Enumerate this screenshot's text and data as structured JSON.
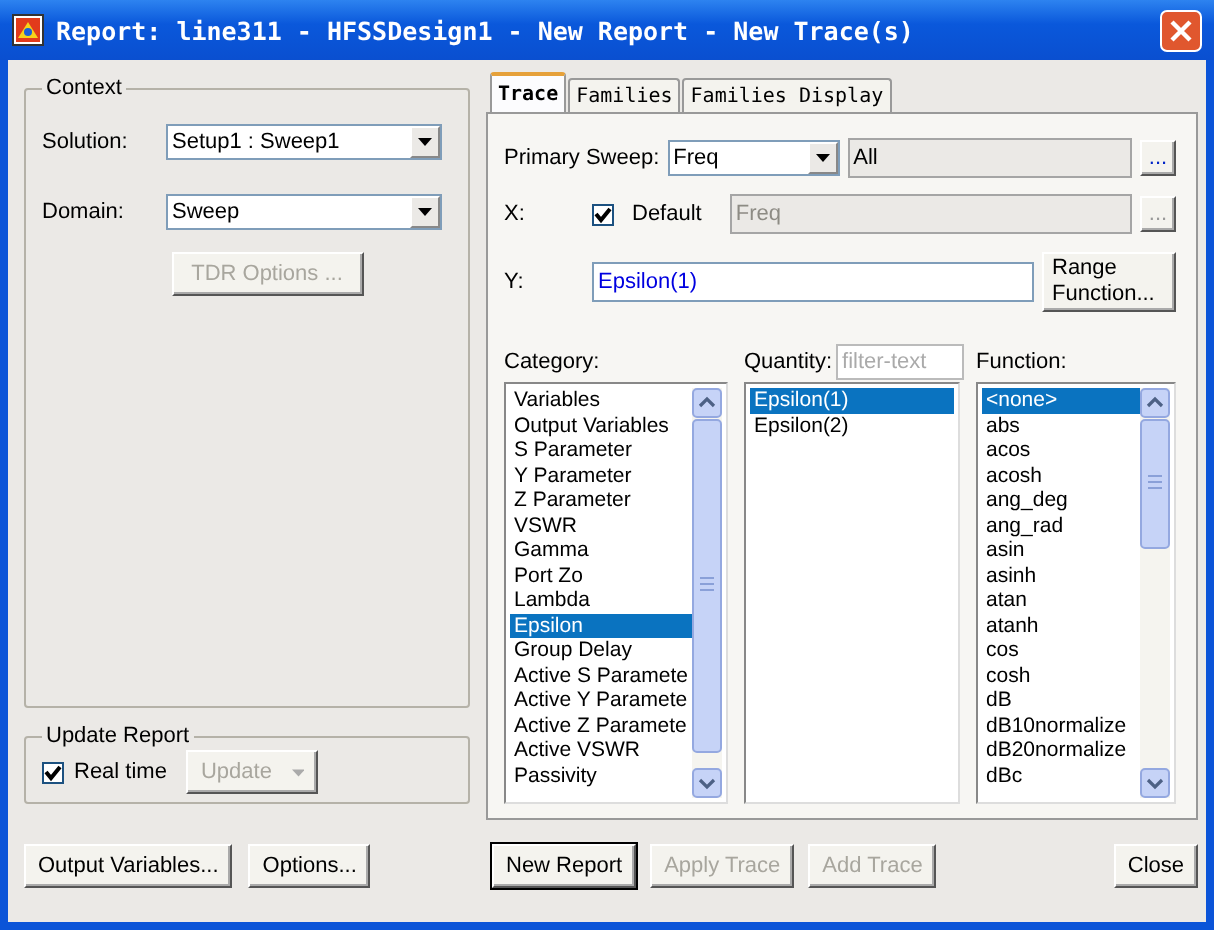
{
  "window": {
    "title": "Report: line311 - HFSSDesign1 - New Report - New Trace(s)"
  },
  "context": {
    "title": "Context",
    "solution": {
      "label": "Solution:",
      "value": "Setup1 : Sweep1"
    },
    "domain": {
      "label": "Domain:",
      "value": "Sweep"
    },
    "tdr_button": {
      "label": "TDR Options ...",
      "disabled": true
    }
  },
  "update_report": {
    "title": "Update Report",
    "real_time": {
      "label": "Real time",
      "checked": true
    },
    "update_button": {
      "label": "Update",
      "disabled": true
    }
  },
  "tabs": [
    {
      "label": "Trace",
      "selected": true
    },
    {
      "label": "Families",
      "selected": false
    },
    {
      "label": "Families Display",
      "selected": false
    }
  ],
  "primary_sweep": {
    "label": "Primary Sweep:",
    "value": "Freq",
    "range": "All",
    "browse": "..."
  },
  "x": {
    "label": "X:",
    "default": {
      "label": "Default",
      "checked": true
    },
    "value": "Freq",
    "browse": "...",
    "disabled": true
  },
  "y": {
    "label": "Y:",
    "value": "Epsilon(1)",
    "range_button": "Range\nFunction..."
  },
  "category": {
    "label": "Category:",
    "items": [
      {
        "label": "Variables",
        "selected": false
      },
      {
        "label": "Output Variables",
        "selected": false
      },
      {
        "label": "S Parameter",
        "selected": false
      },
      {
        "label": "Y Parameter",
        "selected": false
      },
      {
        "label": "Z Parameter",
        "selected": false
      },
      {
        "label": "VSWR",
        "selected": false
      },
      {
        "label": "Gamma",
        "selected": false
      },
      {
        "label": "Port Zo",
        "selected": false
      },
      {
        "label": "Lambda",
        "selected": false
      },
      {
        "label": "Epsilon",
        "selected": true
      },
      {
        "label": "Group Delay",
        "selected": false
      },
      {
        "label": "Active S Paramete",
        "selected": false
      },
      {
        "label": "Active Y Paramete",
        "selected": false
      },
      {
        "label": "Active Z Paramete",
        "selected": false
      },
      {
        "label": "Active VSWR",
        "selected": false
      },
      {
        "label": "Passivity",
        "selected": false
      }
    ]
  },
  "quantity": {
    "label": "Quantity:",
    "filter_placeholder": "filter-text",
    "items": [
      {
        "label": "Epsilon(1)",
        "selected": true
      },
      {
        "label": "Epsilon(2)",
        "selected": false
      }
    ]
  },
  "function": {
    "label": "Function:",
    "items": [
      {
        "label": "<none>",
        "selected": true
      },
      {
        "label": "abs",
        "selected": false
      },
      {
        "label": "acos",
        "selected": false
      },
      {
        "label": "acosh",
        "selected": false
      },
      {
        "label": "ang_deg",
        "selected": false
      },
      {
        "label": "ang_rad",
        "selected": false
      },
      {
        "label": "asin",
        "selected": false
      },
      {
        "label": "asinh",
        "selected": false
      },
      {
        "label": "atan",
        "selected": false
      },
      {
        "label": "atanh",
        "selected": false
      },
      {
        "label": "cos",
        "selected": false
      },
      {
        "label": "cosh",
        "selected": false
      },
      {
        "label": "dB",
        "selected": false
      },
      {
        "label": "dB10normalize",
        "selected": false
      },
      {
        "label": "dB20normalize",
        "selected": false
      },
      {
        "label": "dBc",
        "selected": false
      }
    ]
  },
  "bottom_left_buttons": [
    {
      "label": "Output Variables...",
      "disabled": false
    },
    {
      "label": "Options...",
      "disabled": false
    }
  ],
  "bottom_right_buttons": [
    {
      "label": "New Report",
      "disabled": false,
      "default": true
    },
    {
      "label": "Apply Trace",
      "disabled": true,
      "default": false
    },
    {
      "label": "Add Trace",
      "disabled": true,
      "default": false
    }
  ],
  "close_button": {
    "label": "Close",
    "disabled": false
  }
}
